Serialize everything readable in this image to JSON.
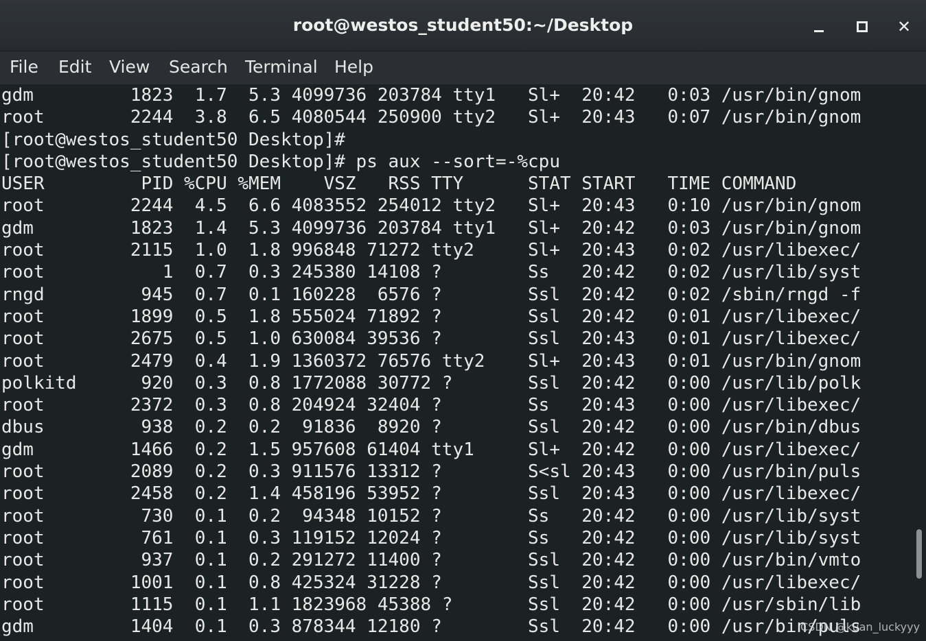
{
  "window": {
    "title": "root@westos_student50:~/Desktop",
    "controls": {
      "minimize_icon": "minimize-icon",
      "maximize_icon": "maximize-icon",
      "close_glyph": "✕"
    }
  },
  "menu": {
    "file": "File",
    "edit": "Edit",
    "view": "View",
    "search": "Search",
    "terminal": "Terminal",
    "help": "Help"
  },
  "terminal": {
    "lines": [
      "gdm         1823  1.7  5.3 4099736 203784 tty1   Sl+  20:42   0:03 /usr/bin/gnom",
      "root        2244  3.8  6.5 4080544 250900 tty2   Sl+  20:43   0:07 /usr/bin/gnom",
      "[root@westos_student50 Desktop]#",
      "[root@westos_student50 Desktop]# ps aux --sort=-%cpu",
      "USER         PID %CPU %MEM    VSZ   RSS TTY      STAT START   TIME COMMAND",
      "root        2244  4.5  6.6 4083552 254012 tty2   Sl+  20:43   0:10 /usr/bin/gnom",
      "gdm         1823  1.4  5.3 4099736 203784 tty1   Sl+  20:42   0:03 /usr/bin/gnom",
      "root        2115  1.0  1.8 996848 71272 tty2     Sl+  20:43   0:02 /usr/libexec/",
      "root           1  0.7  0.3 245380 14108 ?        Ss   20:42   0:02 /usr/lib/syst",
      "rngd         945  0.7  0.1 160228  6576 ?        Ssl  20:42   0:02 /sbin/rngd -f",
      "root        1899  0.5  1.8 555024 71892 ?        Ssl  20:42   0:01 /usr/libexec/",
      "root        2675  0.5  1.0 630084 39536 ?        Ssl  20:43   0:01 /usr/libexec/",
      "root        2479  0.4  1.9 1360372 76576 tty2    Sl+  20:43   0:01 /usr/bin/gnom",
      "polkitd      920  0.3  0.8 1772088 30772 ?       Ssl  20:42   0:00 /usr/lib/polk",
      "root        2372  0.3  0.8 204924 32404 ?        Ss   20:43   0:00 /usr/libexec/",
      "dbus         938  0.2  0.2  91836  8920 ?        Ssl  20:42   0:00 /usr/bin/dbus",
      "gdm         1466  0.2  1.5 957608 61404 tty1     Sl+  20:42   0:00 /usr/libexec/",
      "root        2089  0.2  0.3 911576 13312 ?        S<sl 20:43   0:00 /usr/bin/puls",
      "root        2458  0.2  1.4 458196 53952 ?        Ssl  20:43   0:00 /usr/libexec/",
      "root         730  0.1  0.2  94348 10152 ?        Ss   20:42   0:00 /usr/lib/syst",
      "root         761  0.1  0.3 119152 12024 ?        Ss   20:42   0:00 /usr/lib/syst",
      "root         937  0.1  0.2 291272 11400 ?        Ssl  20:42   0:00 /usr/bin/vmto",
      "root        1001  0.1  0.8 425324 31228 ?        Ssl  20:42   0:00 /usr/libexec/",
      "root        1115  0.1  1.1 1823968 45388 ?       Ssl  20:42   0:00 /usr/sbin/lib",
      "gdm         1404  0.1  0.3 878344 12180 ?        Ssl  20:42   0:00 /usr/bin/puls"
    ]
  },
  "watermark": "CSDN @kuan_luckyyy",
  "colors": {
    "background": "#1c2224",
    "text": "#e8e8e6",
    "titlebar": "#2b2f33"
  }
}
